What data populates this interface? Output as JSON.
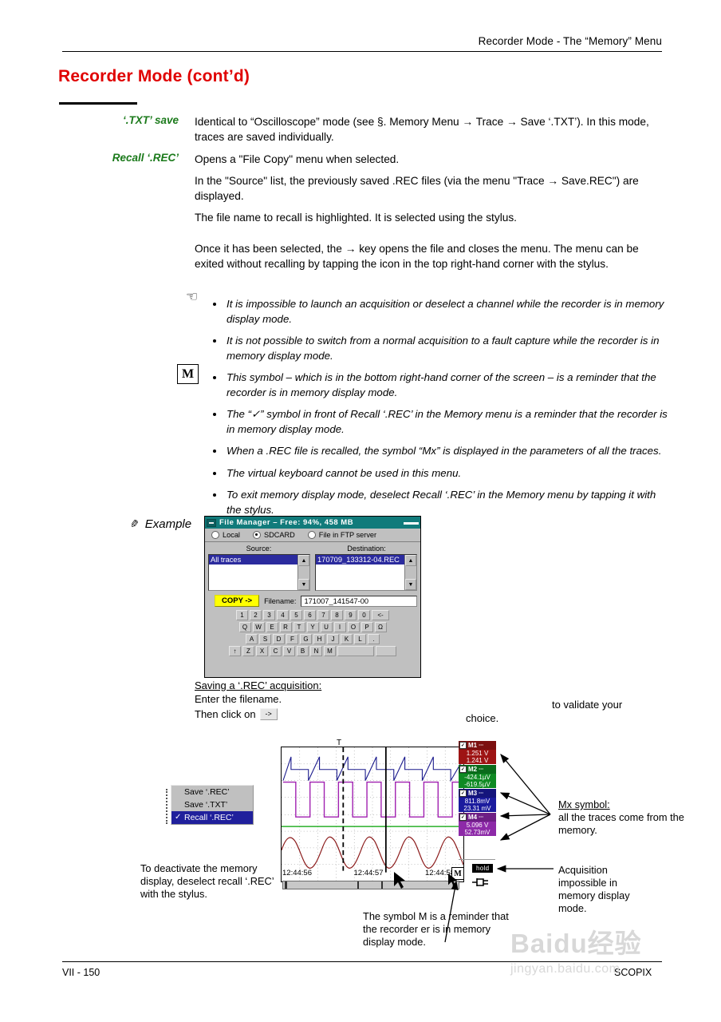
{
  "header": {
    "running_head": "Recorder Mode - The “Memory” Menu"
  },
  "page_title": "Recorder Mode (cont’d)",
  "definitions": [
    {
      "term": "‘.TXT’ save",
      "paragraphs": [
        "Identical to “Oscilloscope” mode (see §. Memory Menu → Trace → Save ‘.TXT’). In this mode, traces are saved individually."
      ]
    },
    {
      "term": "Recall ‘.REC’",
      "paragraphs": [
        "Opens a \"File Copy\" menu when selected.",
        "In the \"Source\" list, the previously saved .REC files (via the menu \"Trace → Save.REC\") are displayed.",
        "The file name to recall is highlighted. It is selected using the stylus.",
        "Once it has been selected, the → key opens the file and closes the menu. The menu can be exited without recalling by tapping the icon in the top right-hand corner with the stylus."
      ]
    }
  ],
  "notes": {
    "hand_icon": "pointing-hand-icon",
    "m_symbol": "M",
    "items": [
      "It is impossible to launch an acquisition or deselect a channel while the recorder is in memory display mode.",
      "It is not possible to switch from a normal acquisition to a fault capture while the recorder is in memory display mode.",
      "This symbol – which is in the bottom right-hand corner of the screen – is a reminder that the recorder is in memory display mode.",
      "The “✓” symbol in front of Recall ‘.REC’ in the Memory menu is a reminder that the recorder is in memory display mode.",
      "When a .REC file is recalled, the symbol “Mx” is displayed in the parameters of all the traces.",
      "The virtual keyboard cannot be used in this menu.",
      "To exit memory display mode, deselect Recall ‘.REC’ in the Memory menu by tapping it with the stylus."
    ]
  },
  "example_label": "Example",
  "file_manager": {
    "title": "File Manager – Free: 94%, 458 MB",
    "close_icon": "close-icon",
    "minimize_icon": "minimize-icon",
    "radios": [
      {
        "label": "Local",
        "selected": false
      },
      {
        "label": "SDCARD",
        "selected": true
      },
      {
        "label": "File in FTP server",
        "selected": false
      }
    ],
    "source_label": "Source:",
    "destination_label": "Destination:",
    "source_items": [
      "All traces"
    ],
    "destination_items": [
      "170709_133312-04.REC"
    ],
    "copy_button": "COPY ->",
    "filename_label": "Filename:",
    "filename_value": "171007_141547-00",
    "keyboard": {
      "row1": [
        "1",
        "2",
        "3",
        "4",
        "5",
        "6",
        "7",
        "8",
        "9",
        "0",
        "<-"
      ],
      "row2": [
        "Q",
        "W",
        "E",
        "R",
        "T",
        "Y",
        "U",
        "I",
        "O",
        "P",
        "Ω"
      ],
      "row3": [
        "A",
        "S",
        "D",
        "F",
        "G",
        "H",
        "J",
        "K",
        "L",
        "."
      ],
      "row4": [
        "↑",
        "Z",
        "X",
        "C",
        "V",
        "B",
        "N",
        "M",
        "",
        ""
      ]
    }
  },
  "save_caption": {
    "line1": "Saving a ‘.REC’ acquisition:",
    "line2": "Enter the filename.",
    "line3": "Then click on",
    "key_label": "->",
    "choice_word": "choice.",
    "validate_word": "to validate your"
  },
  "memory_menu": {
    "items": [
      {
        "label": "Save ‘.REC’",
        "selected": false
      },
      {
        "label": "Save ‘.TXT’",
        "selected": false
      },
      {
        "label": "Recall ‘.REC’",
        "selected": true
      }
    ]
  },
  "scope": {
    "trigger_marker": "T",
    "timestamps": [
      "12:44:56",
      "12:44:57",
      "12:44:58"
    ],
    "memory_badge": "M",
    "hold_badge": "hold",
    "plug_icon": "power-plug-icon",
    "measurements": [
      {
        "name": "M1",
        "color": "#9e1414",
        "head_color": "#7c0f0f",
        "values": [
          "1.251  V",
          "1.241  V"
        ]
      },
      {
        "name": "M2",
        "color": "#0f8a23",
        "head_color": "#0a6b1b",
        "values": [
          "-424.1µV",
          "-619.5µV"
        ]
      },
      {
        "name": "M3",
        "color": "#1b1b9e",
        "head_color": "#14147c",
        "values": [
          "811.8mV",
          "23.31 mV"
        ]
      },
      {
        "name": "M4",
        "color": "#8d2aa8",
        "head_color": "#6e1f85",
        "values": [
          "5.096  V",
          "52.73mV"
        ]
      }
    ]
  },
  "annotations": {
    "deactivate": "To deactivate the memory display, deselect recall ‘.REC’ with the stylus.",
    "mx_title": "Mx symbol:",
    "mx_body": "all the traces come from the memory.",
    "acquisition": "Acquisition impossible in memory display mode.",
    "m_symbol_note": "The symbol M is a reminder that the recorder er is in memory display mode."
  },
  "footer": {
    "page_number": "VII - 150",
    "product": "SCOPIX"
  },
  "watermark": {
    "main": "Baidu经验",
    "sub": "jingyan.baidu.com"
  },
  "colors": {
    "title_red": "#e00000",
    "term_green": "#1b7a1b",
    "titlebar_teal": "#117b7b",
    "copy_yellow": "#ffff00",
    "select_blue": "#2b2b9e"
  }
}
